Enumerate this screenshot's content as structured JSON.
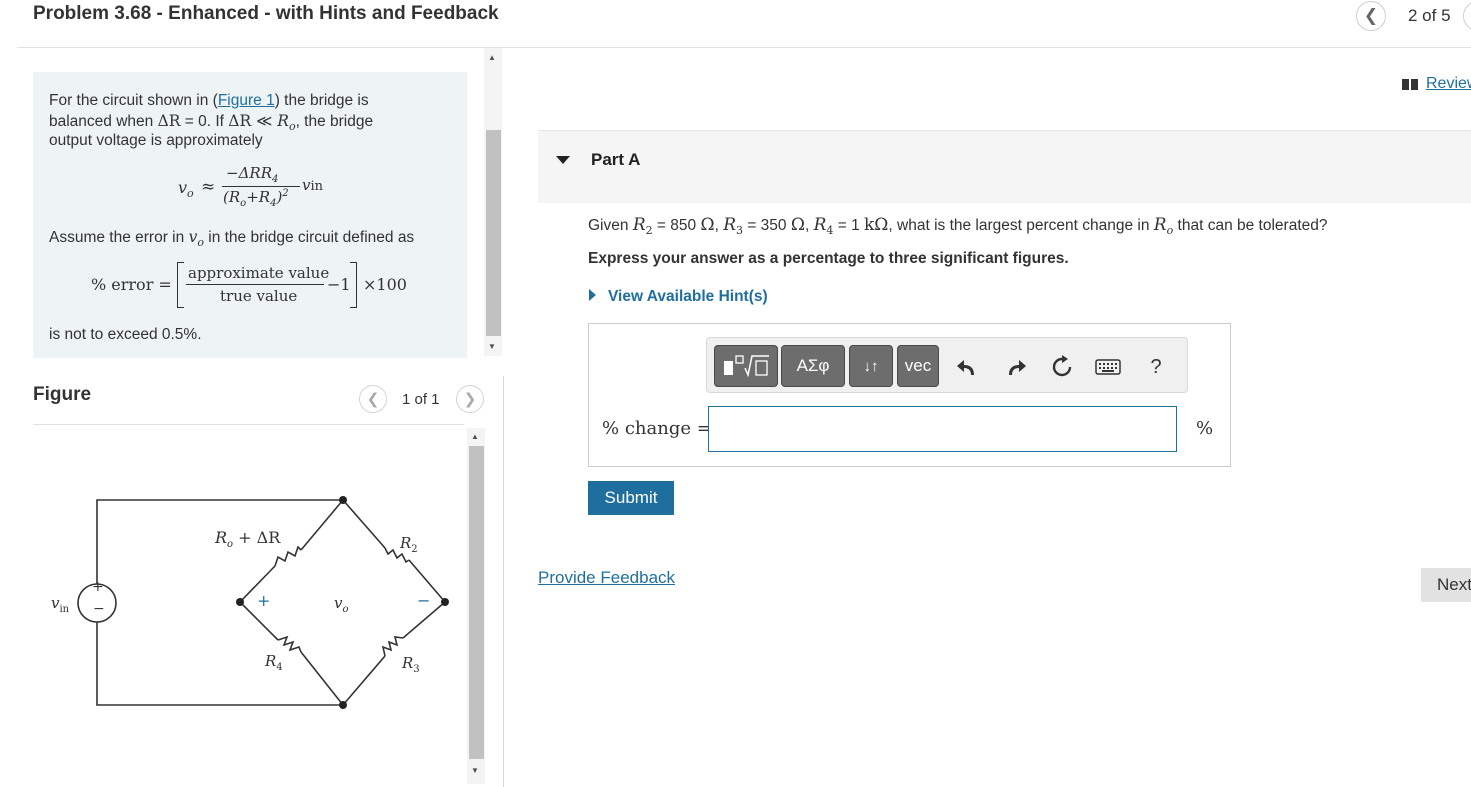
{
  "header": {
    "title": "Problem 3.68 - Enhanced - with Hints and Feedback",
    "prev_icon": "chevron-left-icon",
    "page_count": "2 of 5"
  },
  "problem": {
    "line1_pre": "For the circuit shown in (",
    "figure_link": "Figure 1",
    "line1_post": ") the bridge is",
    "line2_pre": "balanced when ",
    "line2_eq": "ΔR",
    "line2_mid": " = 0. If ",
    "line2_cond_a": "ΔR",
    "line2_cond_op": " ≪ ",
    "line2_cond_b": "R",
    "line2_cond_sub": "o",
    "line2_post": ", the bridge",
    "line3": "output voltage is approximately",
    "formula1": {
      "lhs": "v",
      "lhs_sub": "o",
      "approx": "≈",
      "numerator": "−ΔRR",
      "numerator_sub": "4",
      "denominator": "(R",
      "denominator_sub1": "o",
      "denominator_mid": "+R",
      "denominator_sub2": "4",
      "denominator_close": ")",
      "denominator_exp": "2",
      "rhs": "v",
      "rhs_sub": "in"
    },
    "line4_pre": "Assume the error in ",
    "line4_var": "v",
    "line4_var_sub": "o",
    "line4_post": " in the bridge circuit defined as",
    "formula2": {
      "lhs": "% error =",
      "numerator": "approximate value",
      "denominator": "true value",
      "minus_one": "−1",
      "times": "×100"
    },
    "line5": "is not to exceed 0.5%."
  },
  "figure": {
    "label": "Figure",
    "count": "1 of 1",
    "source_label": "v",
    "source_sub": "in",
    "source_plus": "+",
    "source_minus": "−",
    "top_left_resistor": "R",
    "top_left_sub": "o",
    "top_left_suffix": " + ΔR",
    "top_right_resistor": "R",
    "top_right_sub": "2",
    "bottom_left_resistor": "R",
    "bottom_left_sub": "4",
    "bottom_right_resistor": "R",
    "bottom_right_sub": "3",
    "output_plus": "+",
    "output_label": "v",
    "output_sub": "o",
    "output_minus": "−"
  },
  "review": {
    "label": "Review",
    "icon": "book-icon"
  },
  "part_a": {
    "title": "Part A",
    "q_given": "Given ",
    "r2": "R",
    "r2_sub": "2",
    "r2_val": " = 850 ",
    "r2_unit": "Ω",
    "r3": "R",
    "r3_sub": "3",
    "r3_val": " = 350 ",
    "r3_unit": "Ω",
    "r4": "R",
    "r4_sub": "4",
    "r4_val": " = 1 ",
    "r4_unit": "kΩ",
    "q_rest": ", what is the largest percent change in ",
    "q_var": "R",
    "q_var_sub": "o",
    "q_end": " that can be tolerated?",
    "instruction": "Express your answer as a percentage to three significant figures.",
    "hint_link": "View Available Hint(s)",
    "toolbar": {
      "templates": "templates-icon",
      "greek": "ΑΣφ",
      "arrows": "↓↑",
      "vec": "vec",
      "undo": "undo-icon",
      "redo": "redo-icon",
      "reset": "reset-icon",
      "keyboard": "keyboard-icon",
      "help": "?"
    },
    "answer_label": "% change =",
    "answer_value": "",
    "answer_unit": "%",
    "submit": "Submit"
  },
  "footer": {
    "feedback": "Provide Feedback",
    "next": "Next"
  }
}
